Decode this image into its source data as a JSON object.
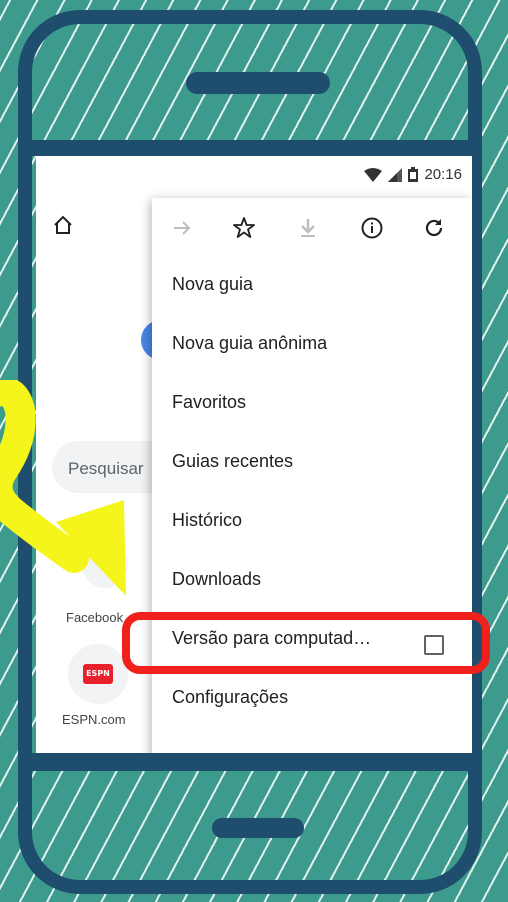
{
  "status_bar": {
    "time": "20:16",
    "icons": [
      "wifi-icon",
      "signal-icon",
      "battery-icon"
    ]
  },
  "browser": {
    "search_placeholder": "Pesquisar",
    "shortcuts": [
      {
        "label": "Facebook"
      },
      {
        "label": "ESPN.com",
        "badge": "ESPN"
      }
    ]
  },
  "menu": {
    "toolbar": [
      "forward-icon",
      "bookmark-star-icon",
      "download-icon",
      "info-icon",
      "refresh-icon"
    ],
    "items": [
      {
        "label": "Nova guia"
      },
      {
        "label": "Nova guia anônima"
      },
      {
        "label": "Favoritos"
      },
      {
        "label": "Guias recentes"
      },
      {
        "label": "Histórico"
      },
      {
        "label": "Downloads"
      },
      {
        "label": "Versão para computad…",
        "checkbox": false
      },
      {
        "label": "Configurações"
      }
    ]
  },
  "colors": {
    "background": "#3d9b8e",
    "phone_frame": "#1e4d6e",
    "highlight": "#f0201d",
    "arrow": "#f5f51c",
    "espn_red": "#e8202a"
  }
}
